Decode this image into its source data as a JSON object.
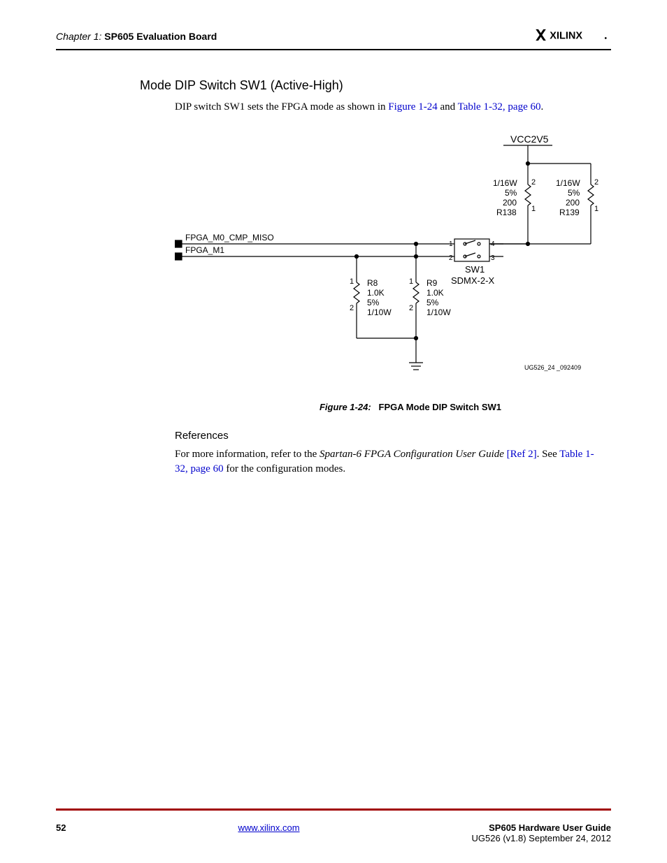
{
  "header": {
    "chapter": "Chapter 1:",
    "title": "SP605 Evaluation Board",
    "brand": "XILINX"
  },
  "section": {
    "heading": "Mode DIP Switch SW1 (Active-High)",
    "intro_a": "DIP switch SW1 sets the FPGA mode as shown in ",
    "intro_link1": "Figure 1-24",
    "intro_b": " and ",
    "intro_link2": "Table 1-32, page 60",
    "intro_c": "."
  },
  "figure": {
    "label": "Figure 1-24:",
    "title": "FPGA Mode DIP Switch SW1",
    "id_text": "UG526_24 _092409",
    "vcc": "VCC2V5",
    "r138": {
      "w": "1/16W",
      "tol": "5%",
      "val": "200",
      "name": "R138"
    },
    "r139": {
      "w": "1/16W",
      "tol": "5%",
      "val": "200",
      "name": "R139"
    },
    "sw1": "SW1",
    "sw1_part": "SDMX-2-X",
    "sig0": "FPGA_M0_CMP_MISO",
    "sig1": "FPGA_M1",
    "r8": {
      "name": "R8",
      "val": "1.0K",
      "tol": "5%",
      "w": "1/10W"
    },
    "r9": {
      "name": "R9",
      "val": "1.0K",
      "tol": "5%",
      "w": "1/10W"
    },
    "pin1": "1",
    "pin2": "2",
    "pin3": "3",
    "pin4": "4"
  },
  "refs": {
    "heading": "References",
    "body_a": "For more information, refer to the ",
    "body_italic": "Spartan-6 FPGA Configuration User Guide",
    "body_b": " ",
    "ref2": "[Ref 2]",
    "body_c": ". See ",
    "link": "Table 1-32, page 60",
    "body_d": " for the configuration modes."
  },
  "footer": {
    "page": "52",
    "url": "www.xilinx.com",
    "doc_title": "SP605 Hardware User Guide",
    "doc_sub": "UG526 (v1.8) September 24, 2012"
  }
}
